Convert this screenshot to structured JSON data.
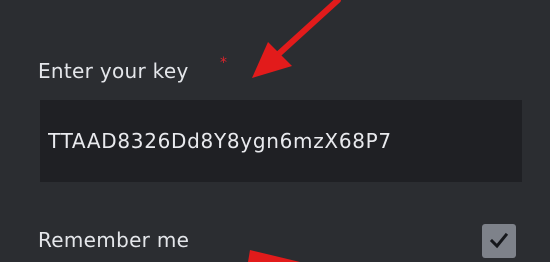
{
  "form": {
    "key_label": "Enter your key",
    "required_marker": "*",
    "key_value": "TTAAD8326Dd8Y8ygn6mzX68P7",
    "remember_label": "Remember me",
    "remember_checked": true
  },
  "colors": {
    "background": "#2b2d31",
    "input_background": "#1f2024",
    "text": "#e4e6ea",
    "required": "#e0242c",
    "checkbox": "#7e828a",
    "annotation_arrow": "#e21b1b"
  },
  "icons": {
    "checkbox_mark": "checkmark-icon",
    "annotation": "red-arrow-icon"
  }
}
